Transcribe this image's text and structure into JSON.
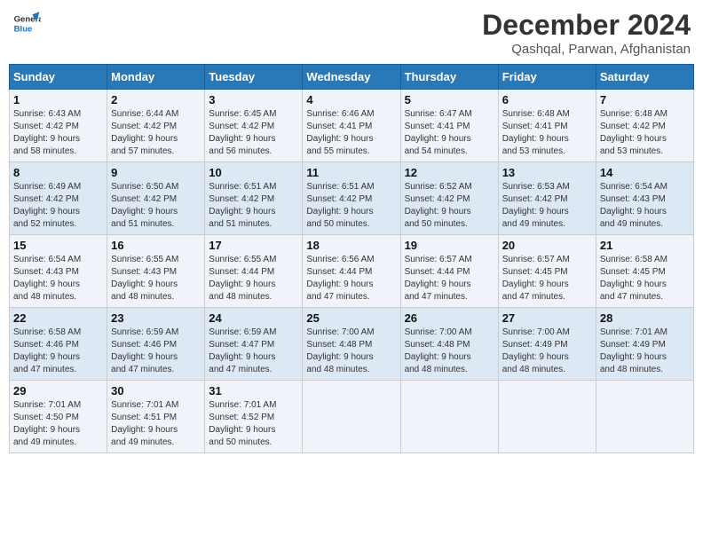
{
  "logo": {
    "line1": "General",
    "line2": "Blue"
  },
  "title": "December 2024",
  "subtitle": "Qashqal, Parwan, Afghanistan",
  "headers": [
    "Sunday",
    "Monday",
    "Tuesday",
    "Wednesday",
    "Thursday",
    "Friday",
    "Saturday"
  ],
  "weeks": [
    [
      {
        "day": "1",
        "info": "Sunrise: 6:43 AM\nSunset: 4:42 PM\nDaylight: 9 hours\nand 58 minutes."
      },
      {
        "day": "2",
        "info": "Sunrise: 6:44 AM\nSunset: 4:42 PM\nDaylight: 9 hours\nand 57 minutes."
      },
      {
        "day": "3",
        "info": "Sunrise: 6:45 AM\nSunset: 4:42 PM\nDaylight: 9 hours\nand 56 minutes."
      },
      {
        "day": "4",
        "info": "Sunrise: 6:46 AM\nSunset: 4:41 PM\nDaylight: 9 hours\nand 55 minutes."
      },
      {
        "day": "5",
        "info": "Sunrise: 6:47 AM\nSunset: 4:41 PM\nDaylight: 9 hours\nand 54 minutes."
      },
      {
        "day": "6",
        "info": "Sunrise: 6:48 AM\nSunset: 4:41 PM\nDaylight: 9 hours\nand 53 minutes."
      },
      {
        "day": "7",
        "info": "Sunrise: 6:48 AM\nSunset: 4:42 PM\nDaylight: 9 hours\nand 53 minutes."
      }
    ],
    [
      {
        "day": "8",
        "info": "Sunrise: 6:49 AM\nSunset: 4:42 PM\nDaylight: 9 hours\nand 52 minutes."
      },
      {
        "day": "9",
        "info": "Sunrise: 6:50 AM\nSunset: 4:42 PM\nDaylight: 9 hours\nand 51 minutes."
      },
      {
        "day": "10",
        "info": "Sunrise: 6:51 AM\nSunset: 4:42 PM\nDaylight: 9 hours\nand 51 minutes."
      },
      {
        "day": "11",
        "info": "Sunrise: 6:51 AM\nSunset: 4:42 PM\nDaylight: 9 hours\nand 50 minutes."
      },
      {
        "day": "12",
        "info": "Sunrise: 6:52 AM\nSunset: 4:42 PM\nDaylight: 9 hours\nand 50 minutes."
      },
      {
        "day": "13",
        "info": "Sunrise: 6:53 AM\nSunset: 4:42 PM\nDaylight: 9 hours\nand 49 minutes."
      },
      {
        "day": "14",
        "info": "Sunrise: 6:54 AM\nSunset: 4:43 PM\nDaylight: 9 hours\nand 49 minutes."
      }
    ],
    [
      {
        "day": "15",
        "info": "Sunrise: 6:54 AM\nSunset: 4:43 PM\nDaylight: 9 hours\nand 48 minutes."
      },
      {
        "day": "16",
        "info": "Sunrise: 6:55 AM\nSunset: 4:43 PM\nDaylight: 9 hours\nand 48 minutes."
      },
      {
        "day": "17",
        "info": "Sunrise: 6:55 AM\nSunset: 4:44 PM\nDaylight: 9 hours\nand 48 minutes."
      },
      {
        "day": "18",
        "info": "Sunrise: 6:56 AM\nSunset: 4:44 PM\nDaylight: 9 hours\nand 47 minutes."
      },
      {
        "day": "19",
        "info": "Sunrise: 6:57 AM\nSunset: 4:44 PM\nDaylight: 9 hours\nand 47 minutes."
      },
      {
        "day": "20",
        "info": "Sunrise: 6:57 AM\nSunset: 4:45 PM\nDaylight: 9 hours\nand 47 minutes."
      },
      {
        "day": "21",
        "info": "Sunrise: 6:58 AM\nSunset: 4:45 PM\nDaylight: 9 hours\nand 47 minutes."
      }
    ],
    [
      {
        "day": "22",
        "info": "Sunrise: 6:58 AM\nSunset: 4:46 PM\nDaylight: 9 hours\nand 47 minutes."
      },
      {
        "day": "23",
        "info": "Sunrise: 6:59 AM\nSunset: 4:46 PM\nDaylight: 9 hours\nand 47 minutes."
      },
      {
        "day": "24",
        "info": "Sunrise: 6:59 AM\nSunset: 4:47 PM\nDaylight: 9 hours\nand 47 minutes."
      },
      {
        "day": "25",
        "info": "Sunrise: 7:00 AM\nSunset: 4:48 PM\nDaylight: 9 hours\nand 48 minutes."
      },
      {
        "day": "26",
        "info": "Sunrise: 7:00 AM\nSunset: 4:48 PM\nDaylight: 9 hours\nand 48 minutes."
      },
      {
        "day": "27",
        "info": "Sunrise: 7:00 AM\nSunset: 4:49 PM\nDaylight: 9 hours\nand 48 minutes."
      },
      {
        "day": "28",
        "info": "Sunrise: 7:01 AM\nSunset: 4:49 PM\nDaylight: 9 hours\nand 48 minutes."
      }
    ],
    [
      {
        "day": "29",
        "info": "Sunrise: 7:01 AM\nSunset: 4:50 PM\nDaylight: 9 hours\nand 49 minutes."
      },
      {
        "day": "30",
        "info": "Sunrise: 7:01 AM\nSunset: 4:51 PM\nDaylight: 9 hours\nand 49 minutes."
      },
      {
        "day": "31",
        "info": "Sunrise: 7:01 AM\nSunset: 4:52 PM\nDaylight: 9 hours\nand 50 minutes."
      },
      {
        "day": "",
        "info": ""
      },
      {
        "day": "",
        "info": ""
      },
      {
        "day": "",
        "info": ""
      },
      {
        "day": "",
        "info": ""
      }
    ]
  ]
}
